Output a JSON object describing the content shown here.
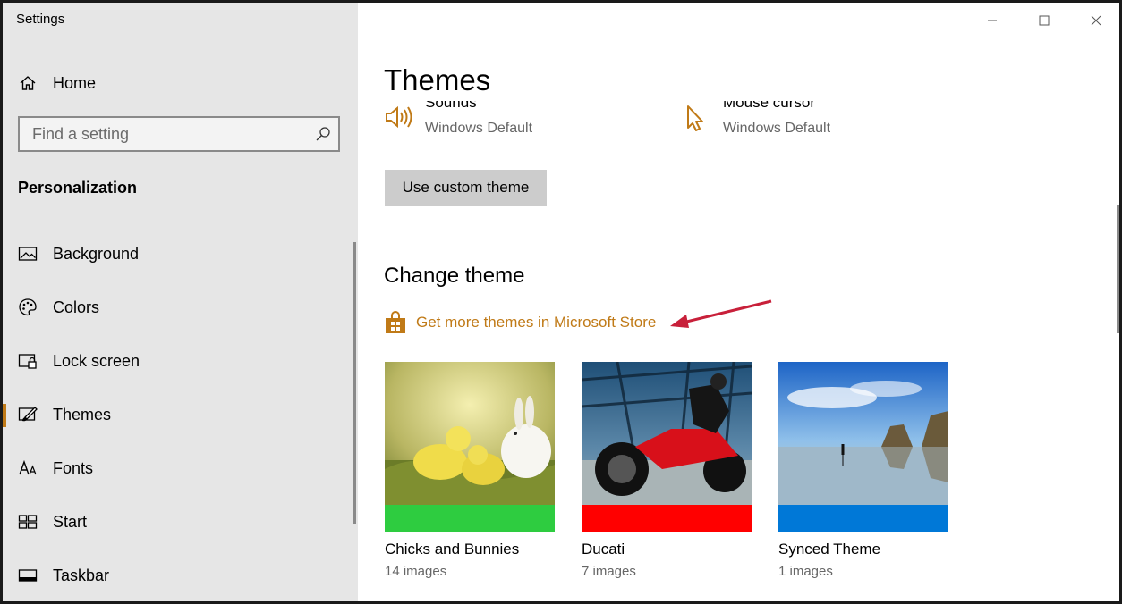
{
  "window": {
    "title": "Settings"
  },
  "sidebar": {
    "home_label": "Home",
    "search": {
      "placeholder": "Find a setting"
    },
    "section_heading": "Personalization",
    "items": [
      {
        "label": "Background",
        "icon": "picture-icon"
      },
      {
        "label": "Colors",
        "icon": "palette-icon"
      },
      {
        "label": "Lock screen",
        "icon": "lock-screen-icon"
      },
      {
        "label": "Themes",
        "icon": "brush-icon",
        "active": true
      },
      {
        "label": "Fonts",
        "icon": "fonts-icon"
      },
      {
        "label": "Start",
        "icon": "start-tiles-icon"
      },
      {
        "label": "Taskbar",
        "icon": "taskbar-icon"
      }
    ]
  },
  "main": {
    "title": "Themes",
    "current_theme_settings": [
      {
        "name": "Sounds",
        "value": "Windows Default",
        "icon": "speaker-icon"
      },
      {
        "name": "Mouse cursor",
        "value": "Windows Default",
        "icon": "cursor-icon"
      }
    ],
    "custom_theme_button": "Use custom theme",
    "change_theme_heading": "Change theme",
    "store_link": "Get more themes in Microsoft Store",
    "themes": [
      {
        "name": "Chicks and Bunnies",
        "count": "14 images",
        "accent": "#2ecc40"
      },
      {
        "name": "Ducati",
        "count": "7 images",
        "accent": "#ff0000"
      },
      {
        "name": "Synced Theme",
        "count": "1 images",
        "accent": "#0078d7"
      }
    ]
  },
  "colors": {
    "accent": "#c07a17",
    "sidebar_bg": "#e6e6e6",
    "annotation_arrow": "#c8203a"
  }
}
